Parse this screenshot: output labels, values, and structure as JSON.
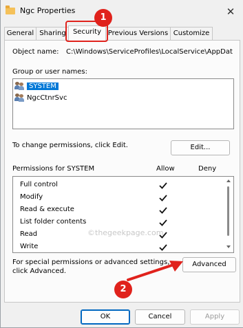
{
  "window": {
    "title": "Ngc Properties"
  },
  "tabs": [
    {
      "label": "General"
    },
    {
      "label": "Sharing"
    },
    {
      "label": "Security"
    },
    {
      "label": "Previous Versions"
    },
    {
      "label": "Customize"
    }
  ],
  "object": {
    "label": "Object name:",
    "value": "C:\\Windows\\ServiceProfiles\\LocalService\\AppDat"
  },
  "groups": {
    "label": "Group or user names:",
    "users": [
      {
        "name": "SYSTEM",
        "selected": true
      },
      {
        "name": "NgcCtnrSvc",
        "selected": false
      }
    ]
  },
  "change_hint": "To change permissions, click Edit.",
  "edit_button": "Edit...",
  "permissions": {
    "label": "Permissions for SYSTEM",
    "allow_label": "Allow",
    "deny_label": "Deny",
    "rows": [
      {
        "name": "Full control",
        "allow": true
      },
      {
        "name": "Modify",
        "allow": true
      },
      {
        "name": "Read & execute",
        "allow": true
      },
      {
        "name": "List folder contents",
        "allow": true
      },
      {
        "name": "Read",
        "allow": true
      },
      {
        "name": "Write",
        "allow": true
      }
    ]
  },
  "advanced": {
    "hint_line1": "For special permissions or advanced settings,",
    "hint_line2": "click Advanced.",
    "button": "Advanced"
  },
  "footer": {
    "ok": "OK",
    "cancel": "Cancel",
    "apply": "Apply"
  },
  "watermark": "©thegeekpage.com",
  "annotations": {
    "step1": "1",
    "step2": "2",
    "color": "#e0221c"
  }
}
